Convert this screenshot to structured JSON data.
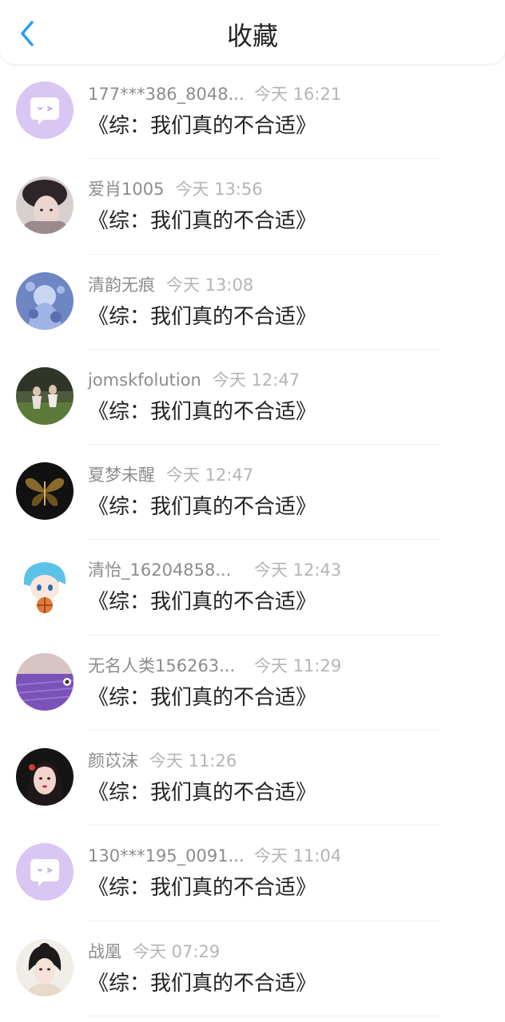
{
  "header": {
    "title": "收藏"
  },
  "items": [
    {
      "name": "177***386_8048...",
      "time": "今天 16:21",
      "title": "《综：我们真的不合适》",
      "avatar": "chat-bubble-icon"
    },
    {
      "name": "爱肖1005",
      "time": "今天 13:56",
      "title": "《综：我们真的不合适》",
      "avatar": "user-photo"
    },
    {
      "name": "清韵无痕",
      "time": "今天 13:08",
      "title": "《综：我们真的不合适》",
      "avatar": "user-photo"
    },
    {
      "name": "jomskfolution",
      "time": "今天 12:47",
      "title": "《综：我们真的不合适》",
      "avatar": "user-photo"
    },
    {
      "name": "夏梦未醒",
      "time": "今天 12:47",
      "title": "《综：我们真的不合适》",
      "avatar": "butterfly-photo"
    },
    {
      "name": "清怡_16204858...",
      "time": "今天 12:43",
      "title": "《综：我们真的不合适》",
      "avatar": "cartoon-photo"
    },
    {
      "name": "无名人类156263...",
      "time": "今天 11:29",
      "title": "《综：我们真的不合适》",
      "avatar": "lavender-photo"
    },
    {
      "name": "颜苡沫",
      "time": "今天 11:26",
      "title": "《综：我们真的不合适》",
      "avatar": "user-photo"
    },
    {
      "name": "130***195_0091...",
      "time": "今天 11:04",
      "title": "《综：我们真的不合适》",
      "avatar": "chat-bubble-icon"
    },
    {
      "name": "战凰",
      "time": "今天 07:29",
      "title": "《综：我们真的不合适》",
      "avatar": "user-photo"
    }
  ],
  "colors": {
    "accent": "#2f9cf2",
    "default_avatar_bg": "#d9c6f2"
  }
}
